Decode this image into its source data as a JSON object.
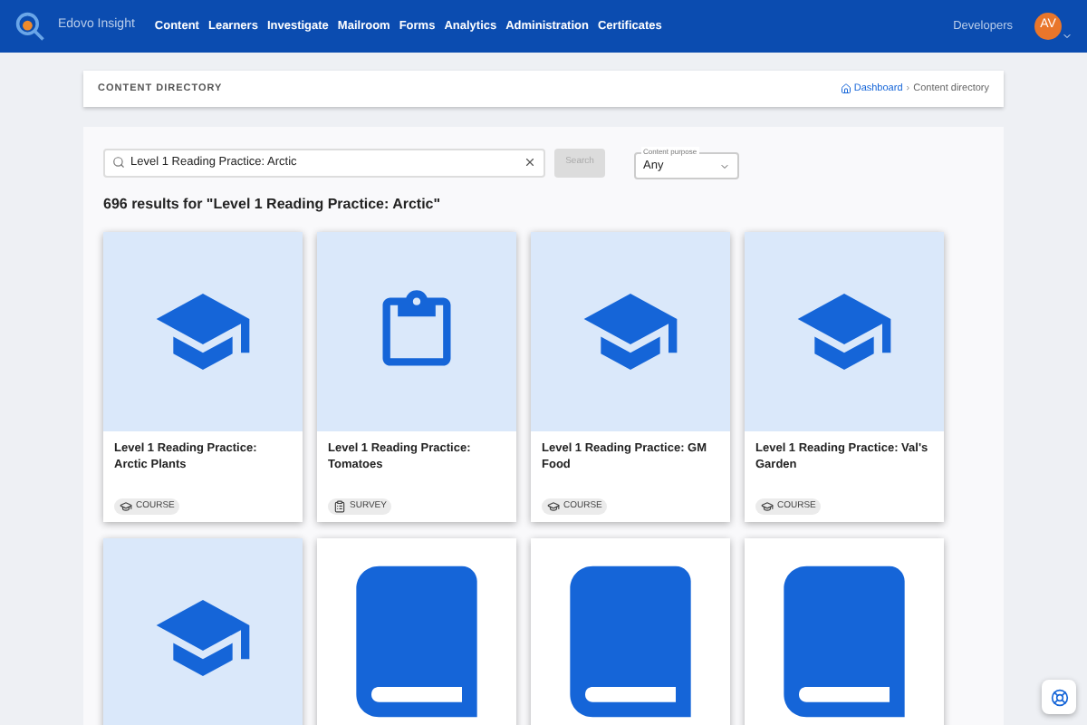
{
  "header": {
    "app_name": "Edovo Insight",
    "nav": [
      "Content",
      "Learners",
      "Investigate",
      "Mailroom",
      "Forms",
      "Analytics",
      "Administration",
      "Certificates"
    ],
    "developers": "Developers",
    "avatar": "AV"
  },
  "page_header": {
    "title": "CONTENT DIRECTORY",
    "breadcrumb_separator": "›",
    "breadcrumbs": [
      {
        "label": "Dashboard",
        "kind": "link"
      },
      {
        "label": "Content directory",
        "kind": "current"
      }
    ]
  },
  "search": {
    "value": "Level 1 Reading Practice: Arctic",
    "button": "Search",
    "button_disabled": true
  },
  "filter": {
    "label": "Content purpose",
    "value": "Any"
  },
  "results_heading": "696 results for \"Level 1 Reading Practice: Arctic\"",
  "cards": [
    {
      "kind": "course",
      "title": "Level 1 Reading Practice: Arctic Plants",
      "tag": "COURSE"
    },
    {
      "kind": "survey",
      "title": "Level 1 Reading Practice: Tomatoes",
      "tag": "SURVEY"
    },
    {
      "kind": "course",
      "title": "Level 1 Reading Practice: GM Food",
      "tag": "COURSE"
    },
    {
      "kind": "course",
      "title": "Level 1 Reading Practice: Val's Garden",
      "tag": "COURSE"
    },
    {
      "kind": "course"
    },
    {
      "kind": "book"
    },
    {
      "kind": "book"
    },
    {
      "kind": "book"
    }
  ]
}
